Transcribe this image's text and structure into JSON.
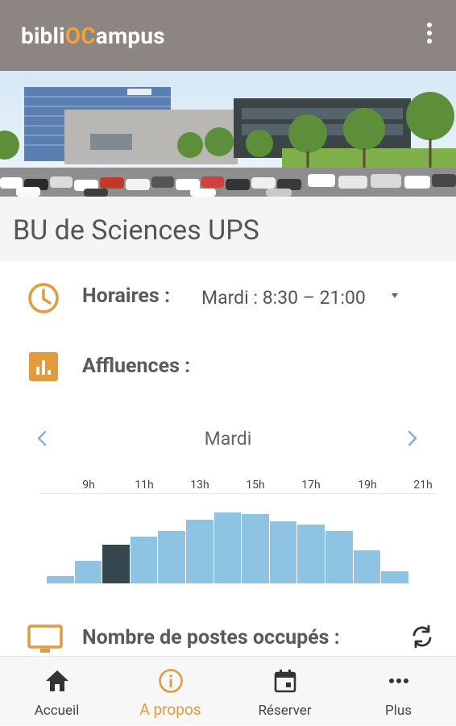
{
  "app": {
    "brand_prefix": "bibli",
    "brand_accent": "OC",
    "brand_suffix": "ampus",
    "accent_color": "#f0a13a",
    "appbar_color": "#8c8582"
  },
  "library": {
    "name": "BU de Sciences UPS"
  },
  "hours": {
    "label": "Horaires :",
    "value": "Mardi : 8:30 – 21:00"
  },
  "attendance": {
    "label": "Affluences :",
    "day": "Mardi",
    "ticks": [
      "9h",
      "11h",
      "13h",
      "15h",
      "17h",
      "19h",
      "21h"
    ]
  },
  "computers": {
    "label": "Nombre de postes occupés :"
  },
  "chart_data": {
    "type": "bar",
    "title": "",
    "xlabel": "",
    "ylabel": "",
    "x_tick_labels": [
      "9h",
      "11h",
      "13h",
      "15h",
      "17h",
      "19h",
      "21h"
    ],
    "categories": [
      "8h",
      "9h",
      "10h",
      "11h",
      "12h",
      "13h",
      "14h",
      "15h",
      "16h",
      "17h",
      "18h",
      "19h",
      "20h"
    ],
    "values": [
      10,
      32,
      54,
      66,
      74,
      90,
      100,
      98,
      88,
      83,
      74,
      47,
      17
    ],
    "highlight_index": 2,
    "highlight_color": "#37474f",
    "bar_color": "#8fc3e3",
    "ylim": [
      0,
      100
    ],
    "grid": false,
    "legend": "none"
  },
  "nav": {
    "items": [
      {
        "label": "Accueil",
        "icon": "home-icon"
      },
      {
        "label": "A propos",
        "icon": "info-icon"
      },
      {
        "label": "Réserver",
        "icon": "calendar-icon"
      },
      {
        "label": "Plus",
        "icon": "more-icon"
      }
    ],
    "active_color": "#e39a3b"
  }
}
